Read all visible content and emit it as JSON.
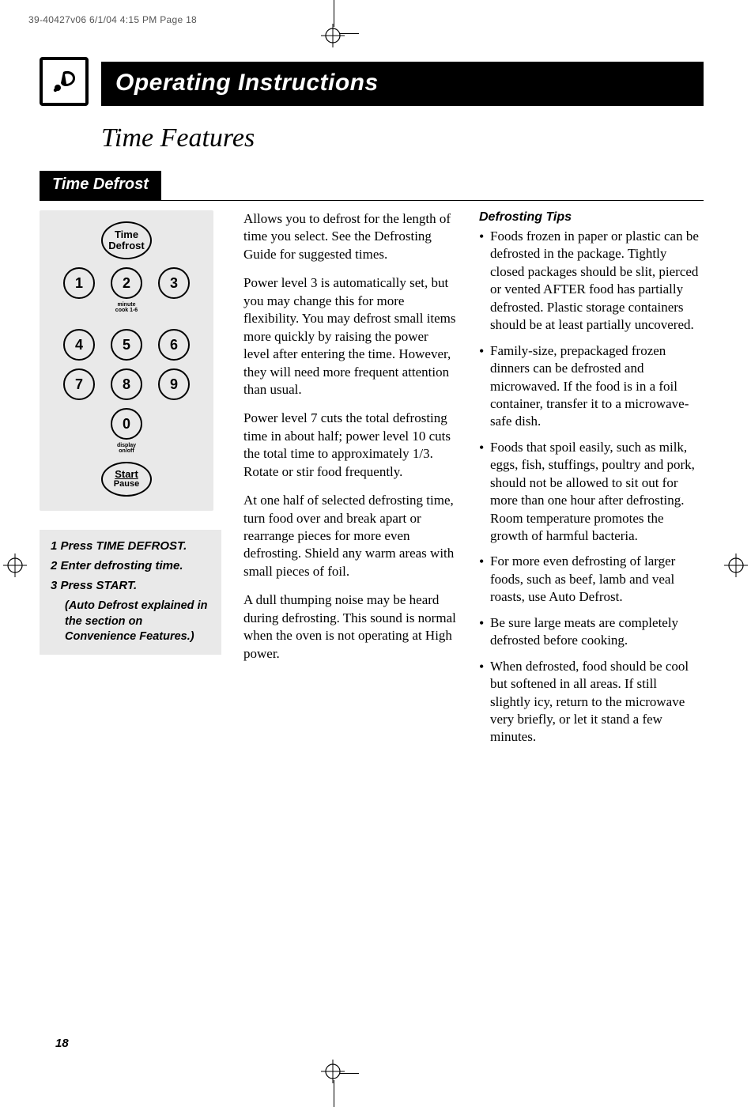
{
  "print_header": "39-40427v06  6/1/04  4:15 PM  Page 18",
  "header_bar": "Operating Instructions",
  "subtitle": "Time Features",
  "section_tab": "Time Defrost",
  "keypad": {
    "time_defrost_line1": "Time",
    "time_defrost_line2": "Defrost",
    "keys": [
      "1",
      "2",
      "3",
      "4",
      "5",
      "6",
      "7",
      "8",
      "9",
      "0"
    ],
    "caption_under_2": "minute cook 1-6",
    "caption_under_0": "display on/off",
    "start_line1": "Start",
    "start_line2": "Pause"
  },
  "steps": {
    "s1": "1  Press TIME DEFROST.",
    "s2": "2  Enter defrosting time.",
    "s3": "3  Press START.",
    "note": "(Auto Defrost explained in the section on Convenience Features.)"
  },
  "mid_paragraphs": [
    "Allows you to defrost for the length of time you select. See the Defrosting Guide for suggested times.",
    "Power level 3 is automatically set, but you may change this for more flexibility. You may defrost small items more quickly by raising the power level after entering the time. However, they will need more frequent attention than usual.",
    "Power level 7 cuts the total defrosting time in about half; power level 10 cuts the total time to approximately 1/3. Rotate or stir food frequently.",
    "At one half of selected defrosting time, turn food over and break apart or rearrange pieces for more even defrosting. Shield any warm areas with small pieces of foil.",
    "A dull thumping noise may be heard during defrosting. This sound is normal when the oven is not operating at High power."
  ],
  "tips_heading": "Defrosting Tips",
  "tips": [
    "Foods frozen in paper or plastic can be defrosted in the package. Tightly closed packages should be slit, pierced or vented AFTER food has partially defrosted. Plastic storage containers should be at least partially uncovered.",
    "Family-size, prepackaged frozen dinners can be defrosted and microwaved. If the food is in a foil container, transfer it to a microwave-safe dish.",
    "Foods that spoil easily, such as milk, eggs, fish, stuffings, poultry and pork, should not be allowed to sit out for more than one hour after defrosting. Room temperature promotes the growth of harmful bacteria.",
    "For more even defrosting of larger foods, such as beef, lamb and veal roasts, use Auto Defrost.",
    "Be sure large meats are completely defrosted before cooking.",
    "When defrosted, food should be cool but softened in all areas. If still slightly icy, return to the microwave very briefly, or let it stand a few minutes."
  ],
  "page_number": "18"
}
